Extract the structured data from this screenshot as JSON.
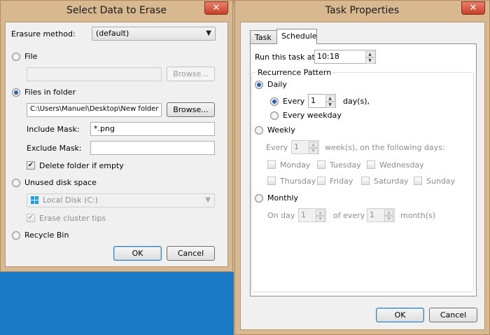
{
  "erase_dialog": {
    "title": "Select Data to Erase",
    "close_glyph": "✕",
    "method_label": "Erasure method:",
    "method_value": "(default)",
    "file_option": "File",
    "file_path": "",
    "file_browse": "Browse...",
    "folder_option": "Files in folder",
    "folder_path": "C:\\Users\\Manuel\\Desktop\\New folder",
    "folder_browse": "Browse...",
    "include_mask_label": "Include Mask:",
    "include_mask_value": "*.png",
    "exclude_mask_label": "Exclude Mask:",
    "exclude_mask_value": "",
    "delete_folder_label": "Delete folder if empty",
    "unused_space_option": "Unused disk space",
    "drive_value": "Local Disk (C:)",
    "erase_cluster_label": "Erase cluster tips",
    "recycle_option": "Recycle Bin",
    "ok": "OK",
    "cancel": "Cancel"
  },
  "task_dialog": {
    "title": "Task Properties",
    "close_glyph": "✕",
    "tabs": [
      "Task",
      "Schedule"
    ],
    "run_at_label": "Run this task at:",
    "run_at_value": "10:18",
    "recurrence_title": "Recurrence Pattern",
    "daily_label": "Daily",
    "every_label": "Every",
    "every_value": "1",
    "days_label": "day(s),",
    "every_weekday_label": "Every weekday",
    "weekly_label": "Weekly",
    "weekly_every_label": "Every",
    "weekly_every_value": "1",
    "weeks_label": "week(s), on the following days:",
    "days": [
      "Monday",
      "Tuesday",
      "Wednesday",
      "Thursday",
      "Friday",
      "Saturday",
      "Sunday"
    ],
    "monthly_label": "Monthly",
    "on_day_label": "On day",
    "on_day_value": "1",
    "of_every_label": "of every",
    "of_every_value": "1",
    "months_label": "month(s)",
    "ok": "OK",
    "cancel": "Cancel"
  }
}
